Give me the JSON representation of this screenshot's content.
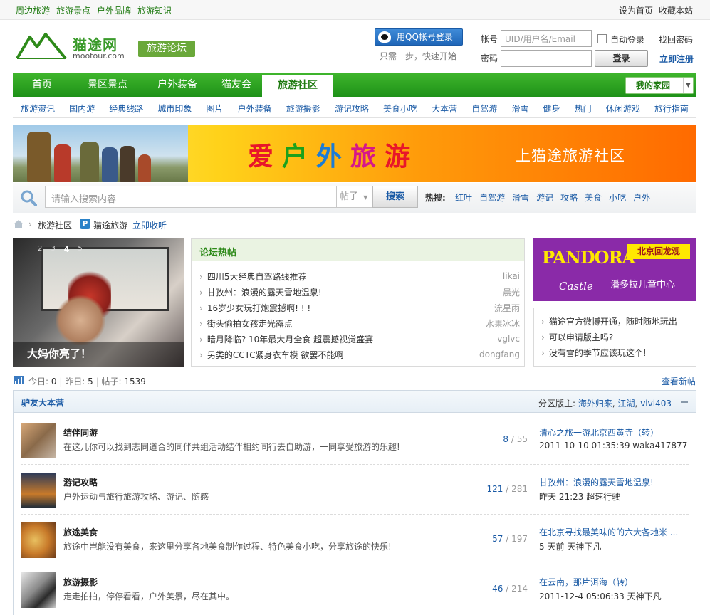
{
  "topbar": {
    "links": [
      "周边旅游",
      "旅游景点",
      "户外品牌",
      "旅游知识"
    ],
    "right": [
      "设为首页",
      "收藏本站"
    ]
  },
  "header": {
    "logo_cn": "猫途网",
    "logo_en": "mootour.com",
    "forum_badge": "旅游论坛",
    "qq_login": "用QQ帐号登录",
    "qq_tip": "只需一步，快速开始",
    "account_label": "帐号",
    "password_label": "密码",
    "user_placeholder": "UID/用户名/Email",
    "auto_login": "自动登录",
    "forgot": "找回密码",
    "login": "登录",
    "register": "立即注册"
  },
  "mainnav": {
    "items": [
      "首页",
      "景区景点",
      "户外装备",
      "猫友会",
      "旅游社区"
    ],
    "active_index": 4,
    "my_home": "我的家园"
  },
  "subnav": [
    "旅游资讯",
    "国内游",
    "经典线路",
    "城市印象",
    "图片",
    "户外装备",
    "旅游摄影",
    "游记攻略",
    "美食小吃",
    "大本营",
    "自驾游",
    "滑雪",
    "健身",
    "热门",
    "休闲游戏",
    "旅行指南"
  ],
  "banner": {
    "slogan": [
      "爱",
      "户",
      "外",
      "旅",
      "游"
    ],
    "right_text": "上猫途旅游社区"
  },
  "search": {
    "placeholder": "请输入搜索内容",
    "type": "帖子",
    "button": "搜索",
    "hot_label": "热搜:",
    "hot_tags": [
      "红叶",
      "自驾游",
      "滑雪",
      "游记",
      "攻略",
      "美食",
      "小吃",
      "户外"
    ]
  },
  "breadcrumb": {
    "section": "旅游社区",
    "app_name": "猫途旅游",
    "app_icon": "P",
    "subscribe": "立即收听"
  },
  "slideshow": {
    "dots": [
      "2",
      "3",
      "4",
      "5"
    ],
    "active_dot": "4",
    "caption": "大妈你亮了！"
  },
  "hot_posts": {
    "title": "论坛热帖",
    "items": [
      {
        "title": "四川5大经典自驾路线推荐",
        "user": "likai"
      },
      {
        "title": "甘孜州：浪漫的露天雪地温泉!",
        "user": "晨光"
      },
      {
        "title": "16岁少女玩打炮震撼啊! ! !",
        "user": "流星雨"
      },
      {
        "title": "街头偷拍女孩走光露点",
        "user": "水果冰冰"
      },
      {
        "title": "暗月降临? 10年最大月全食 超震撼视觉盛宴",
        "user": "vglvc"
      },
      {
        "title": "另类的CCTC紧身衣车模 欲罢不能啊",
        "user": "dongfang"
      }
    ]
  },
  "ad": {
    "logo": "PANDORA",
    "logo2": "Castle",
    "tag": "北京回龙观",
    "subtitle": "潘多拉儿童中心"
  },
  "side_links": [
    "猫途官方微博开通，随时随地玩出",
    "可以申请版主吗?",
    "没有雪的季节应该玩这个!"
  ],
  "stats": {
    "today_label": "今日:",
    "today": "0",
    "yesterday_label": "昨日:",
    "yesterday": "5",
    "posts_label": "帖子:",
    "posts": "1539",
    "new_posts": "查看新帖"
  },
  "group": {
    "title": "驴友大本营",
    "mods_label": "分区版主:",
    "mods": [
      "海外归来",
      "江湖",
      "vivi403"
    ],
    "forums": [
      {
        "name": "结伴同游",
        "desc": "在这儿你可以找到志同道合的同伴共组活动结伴相约同行去自助游，一同享受旅游的乐趣!",
        "threads": "8",
        "posts": "55",
        "last_title": "清心之旅一游北京西黄寺（转）",
        "last_meta": "2011-10-10 01:35:39 waka417877"
      },
      {
        "name": "游记攻略",
        "desc": "户外运动与旅行旅游攻略、游记、随感",
        "threads": "121",
        "posts": "281",
        "last_title": "甘孜州：浪漫的露天雪地温泉!",
        "last_meta": "昨天 21:23 超速行驶"
      },
      {
        "name": "旅途美食",
        "desc": "旅途中岂能没有美食，来这里分享各地美食制作过程、特色美食小吃，分享旅途的快乐!",
        "threads": "57",
        "posts": "197",
        "last_title": "在北京寻找最美味的的六大各地米 ...",
        "last_meta": "5 天前 天神下凡"
      },
      {
        "name": "旅游摄影",
        "desc": "走走拍拍，停停看看，户外美景，尽在其中。",
        "threads": "46",
        "posts": "214",
        "last_title": "在云南，那片洱海（转）",
        "last_meta": "2011-12-4 05:06:33 天神下凡"
      }
    ]
  },
  "icons": {
    "logo": "mountain-logo-icon",
    "qq": "qq-penguin-icon",
    "search": "magnifier-icon",
    "home": "home-icon",
    "stats": "bar-chart-icon",
    "collapse": "minus-icon"
  }
}
